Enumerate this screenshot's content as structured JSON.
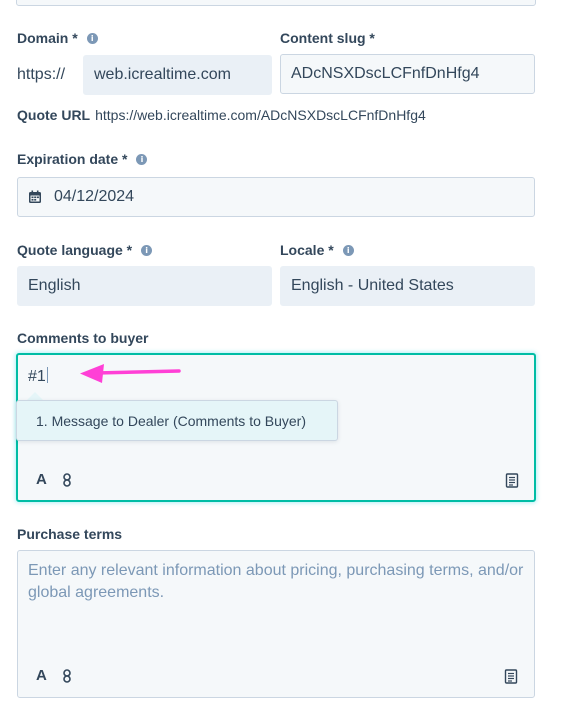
{
  "domain": {
    "label": "Domain *",
    "prefix": "https://",
    "value": "web.icrealtime.com"
  },
  "content_slug": {
    "label": "Content slug *",
    "value": "ADcNSXDscLCFnfDnHfg4"
  },
  "quote_url": {
    "label": "Quote URL",
    "value": "https://web.icrealtime.com/ADcNSXDscLCFnfDnHfg4"
  },
  "expiration_date": {
    "label": "Expiration date *",
    "value": "04/12/2024"
  },
  "quote_language": {
    "label": "Quote language *",
    "value": "English"
  },
  "locale": {
    "label": "Locale *",
    "value": "English - United States"
  },
  "comments": {
    "label": "Comments to buyer",
    "value": "#1",
    "suggestion": "1. Message to Dealer (Comments to Buyer)"
  },
  "purchase_terms": {
    "label": "Purchase terms",
    "placeholder": "Enter any relevant information about pricing, purchasing terms, and/or global agreements."
  },
  "toolbar": {
    "font_label": "A"
  },
  "icons": [
    "info-icon",
    "calendar-icon",
    "link-icon",
    "snippet-icon",
    "arrow-annotation"
  ],
  "colors": {
    "focus_border": "#00bda5",
    "annotation_arrow": "#ff40d6",
    "suggestion_bg": "#e5f5f8"
  }
}
